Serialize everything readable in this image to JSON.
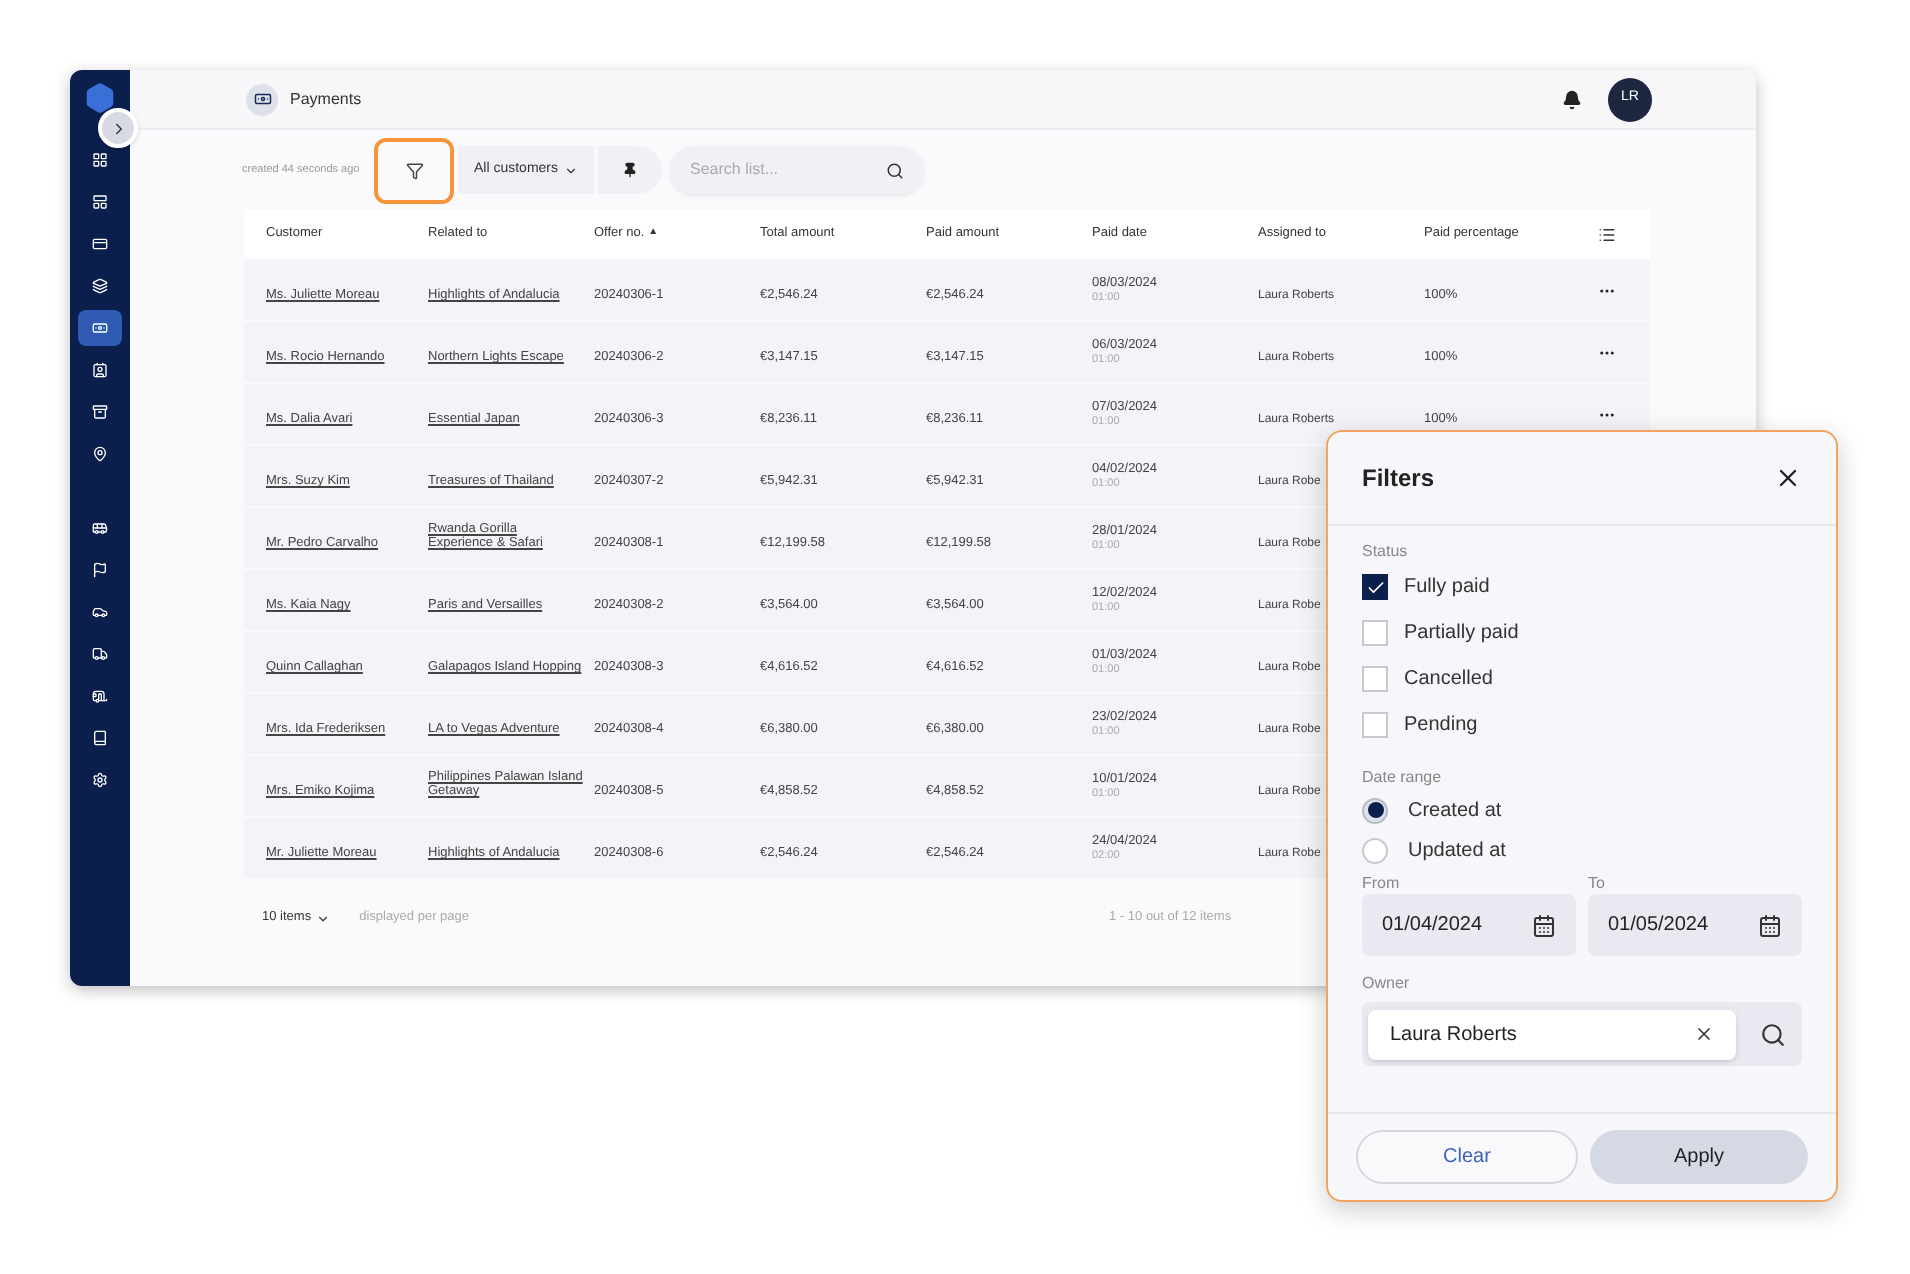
{
  "sidebar": {
    "items": [
      {
        "selected": false
      },
      {
        "selected": false
      },
      {
        "selected": false
      },
      {
        "selected": false
      },
      {
        "selected": true
      },
      {
        "selected": false
      },
      {
        "selected": false
      },
      {
        "selected": false
      },
      {
        "selected": false
      },
      {
        "selected": false
      },
      {
        "selected": false
      },
      {
        "selected": false
      },
      {
        "selected": false
      },
      {
        "selected": false
      },
      {
        "selected": false
      }
    ]
  },
  "header": {
    "title": "Payments",
    "avatar": "LR"
  },
  "toolbar": {
    "created": "created 44 seconds ago",
    "customers": "All customers",
    "search_placeholder": "Search list..."
  },
  "table": {
    "columns": [
      {
        "label": "Customer"
      },
      {
        "label": "Related to"
      },
      {
        "label": "Offer no.",
        "sort": "▲"
      },
      {
        "label": "Total amount"
      },
      {
        "label": "Paid amount"
      },
      {
        "label": "Paid date"
      },
      {
        "label": "Assigned to"
      },
      {
        "label": "Paid percentage"
      }
    ],
    "rows": [
      {
        "customer": "Ms. Juliette Moreau",
        "related": "Highlights of Andalucia",
        "offer": "20240306-1",
        "total": "€2,546.24",
        "paid": "€2,546.24",
        "date": "08/03/2024",
        "time": "01:00",
        "assigned": "Laura Roberts",
        "percent": "100%"
      },
      {
        "customer": "Ms. Rocio Hernando",
        "related": "Northern Lights Escape",
        "offer": "20240306-2",
        "total": "€3,147.15",
        "paid": "€3,147.15",
        "date": "06/03/2024",
        "time": "01:00",
        "assigned": "Laura Roberts",
        "percent": "100%"
      },
      {
        "customer": "Ms. Dalia Avari",
        "related": "Essential Japan",
        "offer": "20240306-3",
        "total": "€8,236.11",
        "paid": "€8,236.11",
        "date": "07/03/2024",
        "time": "01:00",
        "assigned": "Laura Roberts",
        "percent": "100%"
      },
      {
        "customer": "Mrs. Suzy Kim",
        "related": "Treasures of Thailand",
        "offer": "20240307-2",
        "total": "€5,942.31",
        "paid": "€5,942.31",
        "date": "04/02/2024",
        "time": "01:00",
        "assigned": "Laura Robe"
      },
      {
        "customer": "Mr. Pedro Carvalho",
        "related": "Rwanda Gorilla Experience & Safari",
        "offer": "20240308-1",
        "total": "€12,199.58",
        "paid": "€12,199.58",
        "date": "28/01/2024",
        "time": "01:00",
        "assigned": "Laura Robe"
      },
      {
        "customer": "Ms. Kaia Nagy",
        "related": "Paris and Versailles",
        "offer": "20240308-2",
        "total": "€3,564.00",
        "paid": "€3,564.00",
        "date": "12/02/2024",
        "time": "01:00",
        "assigned": "Laura Robe"
      },
      {
        "customer": "Quinn Callaghan",
        "related": "Galapagos Island Hopping",
        "offer": "20240308-3",
        "total": "€4,616.52",
        "paid": "€4,616.52",
        "date": "01/03/2024",
        "time": "01:00",
        "assigned": "Laura Robe"
      },
      {
        "customer": "Mrs. Ida Frederiksen",
        "related": "LA to Vegas Adventure",
        "offer": "20240308-4",
        "total": "€6,380.00",
        "paid": "€6,380.00",
        "date": "23/02/2024",
        "time": "01:00",
        "assigned": "Laura Robe"
      },
      {
        "customer": "Mrs. Emiko Kojima",
        "related": "Philippines Palawan Island Getaway",
        "offer": "20240308-5",
        "total": "€4,858.52",
        "paid": "€4,858.52",
        "date": "10/01/2024",
        "time": "01:00",
        "assigned": "Laura Robe"
      },
      {
        "customer": "Mr. Juliette Moreau",
        "related": "Highlights of Andalucia",
        "offer": "20240308-6",
        "total": "€2,546.24",
        "paid": "€2,546.24",
        "date": "24/04/2024",
        "time": "02:00",
        "assigned": "Laura Robe"
      }
    ]
  },
  "footer": {
    "per_page": "10 items",
    "per_page_label": "displayed per page",
    "range": "1 - 10 out of 12 items"
  },
  "filters": {
    "title": "Filters",
    "status_label": "Status",
    "statuses": [
      {
        "label": "Fully paid",
        "checked": true
      },
      {
        "label": "Partially paid",
        "checked": false
      },
      {
        "label": "Cancelled",
        "checked": false
      },
      {
        "label": "Pending",
        "checked": false
      }
    ],
    "date_label": "Date range",
    "date_options": [
      {
        "label": "Created at",
        "selected": true
      },
      {
        "label": "Updated at",
        "selected": false
      }
    ],
    "from_label": "From",
    "from": "01/04/2024",
    "to_label": "To",
    "to": "01/05/2024",
    "owner_label": "Owner",
    "owner": "Laura Roberts",
    "buttons": [
      "Clear",
      "Apply"
    ]
  }
}
